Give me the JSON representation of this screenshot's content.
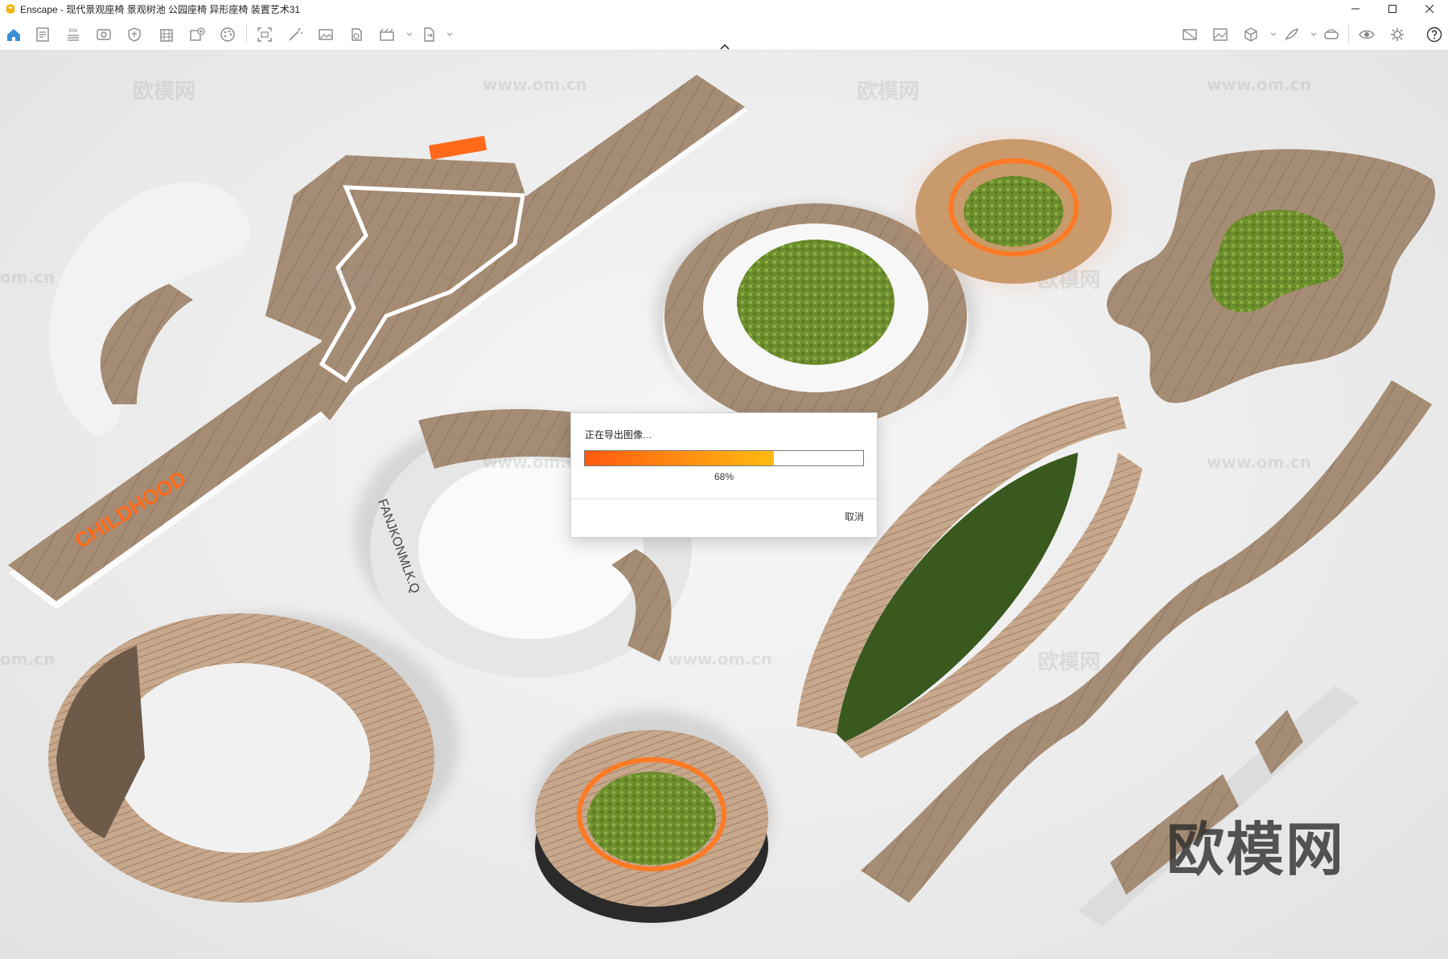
{
  "window": {
    "title": "Enscape - 现代景观座椅 景观树池 公园座椅 异形座椅 装置艺术31",
    "controls": [
      "minimize",
      "maximize",
      "close"
    ]
  },
  "toolbar": {
    "left_tools": [
      {
        "id": "home",
        "icon": "home-icon"
      },
      {
        "id": "notes",
        "icon": "notes-icon"
      },
      {
        "id": "bim",
        "icon": "bim-icon",
        "label": "BIM"
      },
      {
        "id": "views",
        "icon": "eye-view-icon"
      },
      {
        "id": "shield",
        "icon": "shield-icon"
      },
      {
        "id": "building",
        "icon": "building-icon"
      },
      {
        "id": "asset-library",
        "icon": "asset-add-icon"
      },
      {
        "id": "materials",
        "icon": "palette-icon"
      },
      {
        "id": "capture",
        "icon": "capture-icon"
      },
      {
        "id": "magic-wand",
        "icon": "magic-wand-icon"
      },
      {
        "id": "image-export",
        "icon": "image-icon"
      },
      {
        "id": "panorama",
        "icon": "panorama-icon"
      },
      {
        "id": "video-editor",
        "icon": "video-icon"
      },
      {
        "id": "export-file",
        "icon": "export-icon"
      }
    ],
    "right_tools": [
      {
        "id": "no-image",
        "icon": "no-image-icon"
      },
      {
        "id": "gallery",
        "icon": "gallery-icon"
      },
      {
        "id": "cube",
        "icon": "cube-icon"
      },
      {
        "id": "feather",
        "icon": "feather-icon"
      },
      {
        "id": "vr-headset",
        "icon": "vr-headset-icon"
      },
      {
        "id": "visibility",
        "icon": "eye-icon"
      },
      {
        "id": "settings",
        "icon": "gear-icon"
      },
      {
        "id": "help",
        "icon": "help-icon"
      }
    ]
  },
  "watermarks": [
    "欧模网",
    "www.om.cn",
    "om.cn"
  ],
  "brand_mark": "欧模网",
  "dialog": {
    "title": "正在导出图像…",
    "progress": 0.68,
    "progress_label": "68%",
    "cancel_label": "取消",
    "accent": "#ff7a10"
  }
}
